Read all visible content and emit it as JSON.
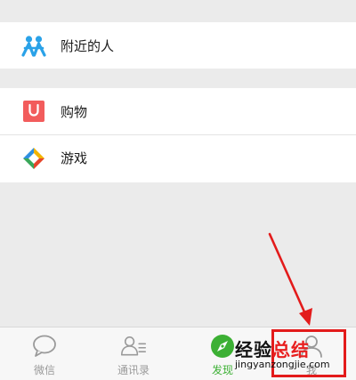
{
  "menu": {
    "group1": [
      {
        "label": "附近的人",
        "icon": "people-nearby-icon"
      }
    ],
    "group2": [
      {
        "label": "购物",
        "icon": "shopping-bag-icon"
      },
      {
        "label": "游戏",
        "icon": "games-icon"
      }
    ]
  },
  "tabbar": {
    "tabs": [
      {
        "label": "微信",
        "icon": "chat-bubble-icon",
        "active": false
      },
      {
        "label": "通讯录",
        "icon": "contacts-icon",
        "active": false
      },
      {
        "label": "发现",
        "icon": "compass-icon",
        "active": true
      },
      {
        "label": "我",
        "icon": "person-icon",
        "active": false
      }
    ]
  },
  "watermark": {
    "title_part1": "经验",
    "title_part2": "总结",
    "url": "jingyanzongjie.com"
  },
  "colors": {
    "accent_green": "#3cb034",
    "annotation_red": "#e31b1b",
    "nearby_blue": "#2aa2e8",
    "shopping_red": "#f25c5c"
  }
}
